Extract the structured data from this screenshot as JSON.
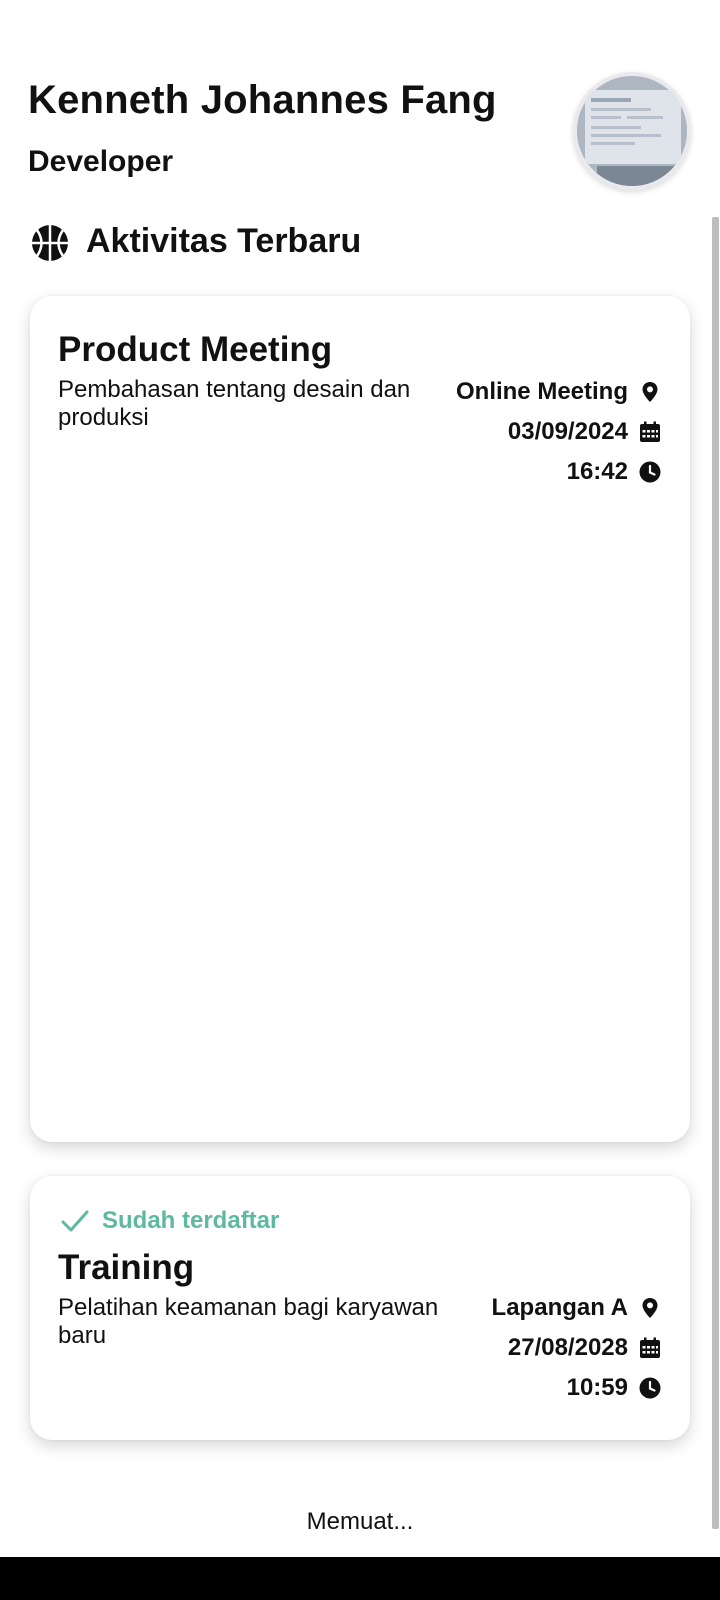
{
  "profile": {
    "name": "Kenneth Johannes Fang",
    "role": "Developer",
    "avatar_icon": "profile-photo"
  },
  "section": {
    "icon": "basketball-icon",
    "title": "Aktivitas Terbaru"
  },
  "activities": [
    {
      "title": "Product Meeting",
      "description": "Pembahasan tentang desain dan produksi",
      "location": "Online Meeting",
      "date": "03/09/2024",
      "time": "16:42",
      "registered": false
    },
    {
      "status": "Sudah terdaftar",
      "title": "Training",
      "description": "Pelatihan keamanan bagi karyawan baru",
      "location": "Lapangan A",
      "date": "27/08/2028",
      "time": "10:59",
      "registered": true
    }
  ],
  "loading_text": "Memuat...",
  "colors": {
    "accent": "#5fb8a0",
    "text": "#111111",
    "background": "#ffffff"
  }
}
